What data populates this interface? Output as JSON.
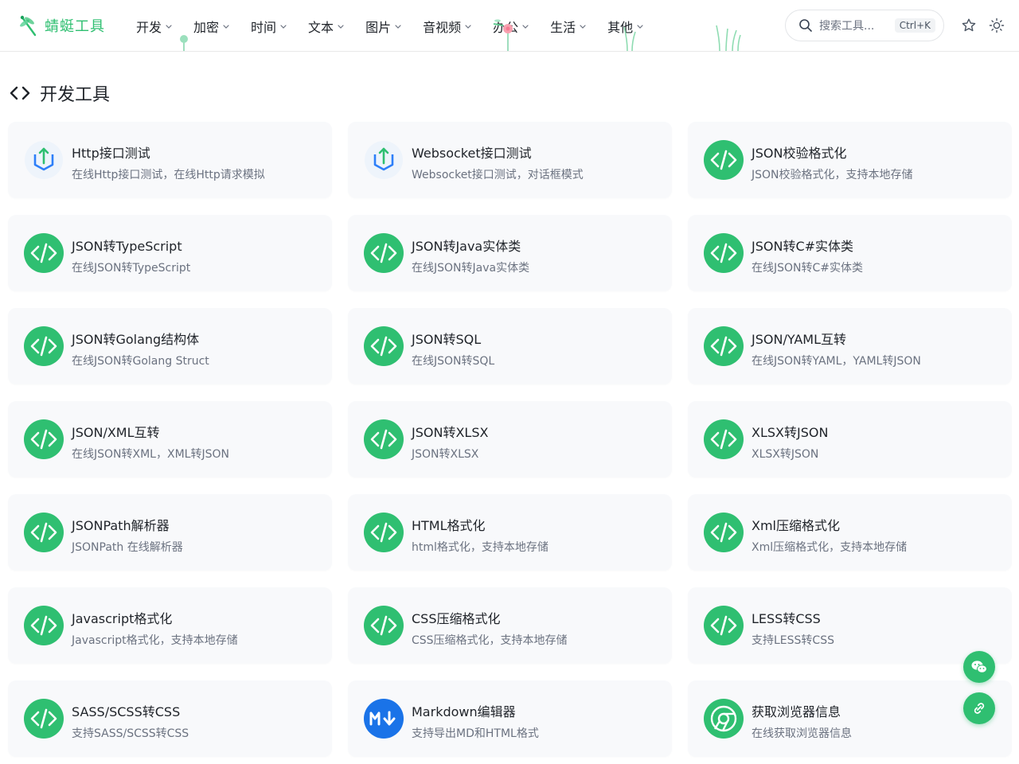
{
  "header": {
    "logo_text": "蜻蜓工具",
    "nav": [
      {
        "label": "开发"
      },
      {
        "label": "加密"
      },
      {
        "label": "时间"
      },
      {
        "label": "文本"
      },
      {
        "label": "图片"
      },
      {
        "label": "音视频"
      },
      {
        "label": "办公"
      },
      {
        "label": "生活"
      },
      {
        "label": "其他"
      }
    ],
    "search_placeholder": "搜索工具...",
    "search_shortcut": "Ctrl+K"
  },
  "section": {
    "title": "开发工具"
  },
  "tools": [
    {
      "name": "Http接口测试",
      "desc": "在线Http接口测试，在线Http请求模拟",
      "icon": "http-icon"
    },
    {
      "name": "Websocket接口测试",
      "desc": "Websocket接口测试，对话框模式",
      "icon": "websocket-icon"
    },
    {
      "name": "JSON校验格式化",
      "desc": "JSON校验格式化，支持本地存储",
      "icon": "code-icon"
    },
    {
      "name": "JSON转TypeScript",
      "desc": "在线JSON转TypeScript",
      "icon": "code-icon"
    },
    {
      "name": "JSON转Java实体类",
      "desc": "在线JSON转Java实体类",
      "icon": "code-icon"
    },
    {
      "name": "JSON转C#实体类",
      "desc": "在线JSON转C#实体类",
      "icon": "code-icon"
    },
    {
      "name": "JSON转Golang结构体",
      "desc": "在线JSON转Golang Struct",
      "icon": "code-icon"
    },
    {
      "name": "JSON转SQL",
      "desc": "在线JSON转SQL",
      "icon": "code-icon"
    },
    {
      "name": "JSON/YAML互转",
      "desc": "在线JSON转YAML，YAML转JSON",
      "icon": "code-icon"
    },
    {
      "name": "JSON/XML互转",
      "desc": "在线JSON转XML，XML转JSON",
      "icon": "code-icon"
    },
    {
      "name": "JSON转XLSX",
      "desc": "JSON转XLSX",
      "icon": "code-icon"
    },
    {
      "name": "XLSX转JSON",
      "desc": "XLSX转JSON",
      "icon": "code-icon"
    },
    {
      "name": "JSONPath解析器",
      "desc": "JSONPath 在线解析器",
      "icon": "code-icon"
    },
    {
      "name": "HTML格式化",
      "desc": "html格式化，支持本地存储",
      "icon": "code-icon"
    },
    {
      "name": "Xml压缩格式化",
      "desc": "Xml压缩格式化，支持本地存储",
      "icon": "code-icon"
    },
    {
      "name": "Javascript格式化",
      "desc": "Javascript格式化，支持本地存储",
      "icon": "code-icon"
    },
    {
      "name": "CSS压缩格式化",
      "desc": "CSS压缩格式化，支持本地存储",
      "icon": "code-icon"
    },
    {
      "name": "LESS转CSS",
      "desc": "支持LESS转CSS",
      "icon": "code-icon"
    },
    {
      "name": "SASS/SCSS转CSS",
      "desc": "支持SASS/SCSS转CSS",
      "icon": "code-icon"
    },
    {
      "name": "Markdown编辑器",
      "desc": "支持导出MD和HTML格式",
      "icon": "markdown-icon"
    },
    {
      "name": "获取浏览器信息",
      "desc": "在线获取浏览器信息",
      "icon": "browser-icon"
    }
  ],
  "colors": {
    "brand": "#2fbf71",
    "markdown": "#1a73e8",
    "websocket": "#2d7ff9"
  }
}
